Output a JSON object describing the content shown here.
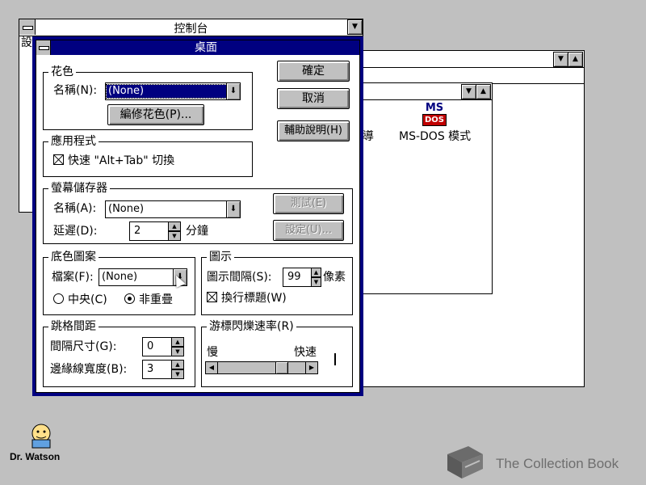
{
  "control_panel": {
    "title": "控制台",
    "partial_letter": "設"
  },
  "mid_window": {
    "icon_label_partial": "導",
    "icon_label_msdos": "MS-DOS 模式",
    "msdos_logo_top": "MS",
    "msdos_logo_bottom": "DOS"
  },
  "dialog": {
    "title": "桌面",
    "buttons": {
      "ok": "確定",
      "cancel": "取消",
      "help": "輔助說明(H)"
    },
    "pattern": {
      "group_label": "花色",
      "name_label": "名稱(N):",
      "name_value": "(None)",
      "edit_button": "編修花色(P)..."
    },
    "applications": {
      "group_label": "應用程式",
      "fast_switch_label": "快速 \"Alt+Tab\" 切換",
      "fast_switch_checked": true
    },
    "screen_saver": {
      "group_label": "螢幕儲存器",
      "name_label": "名稱(A):",
      "name_value": "(None)",
      "delay_label": "延遲(D):",
      "delay_value": "2",
      "delay_unit": "分鐘",
      "test_button": "測試(E)",
      "setup_button": "設定(U)..."
    },
    "wallpaper": {
      "group_label": "底色圖案",
      "file_label": "檔案(F):",
      "file_value": "(None)",
      "center_label": "中央(C)",
      "tile_label": "非重疊",
      "selected": "tile"
    },
    "icons": {
      "group_label": "圖示",
      "spacing_label": "圖示間隔(S):",
      "spacing_value": "99",
      "spacing_unit": "像素",
      "wrap_title_label": "換行標題(W)",
      "wrap_title_checked": true
    },
    "sizing_grid": {
      "group_label": "跳格間距",
      "granularity_label": "間隔尺寸(G):",
      "granularity_value": "0",
      "border_width_label": "邊緣線寬度(B):",
      "border_width_value": "3"
    },
    "cursor_blink": {
      "group_label": "游標閃爍速率(R)",
      "slow_label": "慢",
      "fast_label": "快速",
      "rate_fraction": 0.75
    }
  },
  "desktop": {
    "dr_watson_label": "Dr. Watson"
  },
  "watermark": {
    "text": "The Collection Book"
  },
  "colors": {
    "desktop": "#c0c0c0",
    "dialog_frame": "#000080",
    "selection": "#000080"
  }
}
